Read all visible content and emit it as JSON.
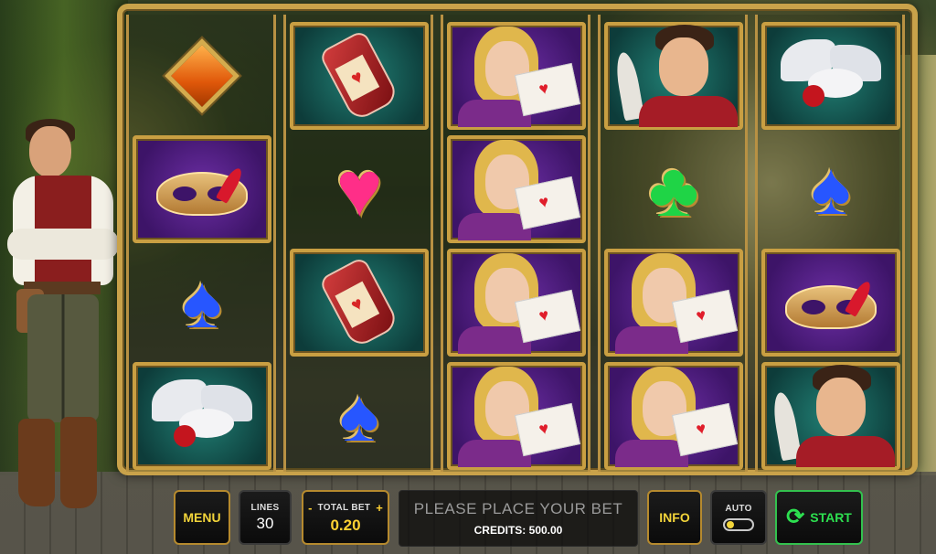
{
  "game": {
    "message": "PLEASE PLACE YOUR BET",
    "credits_label": "CREDITS: 500.00"
  },
  "controls": {
    "menu_label": "MENU",
    "lines_label": "LINES",
    "lines_value": "30",
    "bet_minus": "-",
    "bet_label": "TOTAL BET",
    "bet_plus": "+",
    "bet_value": "0.20",
    "info_label": "INFO",
    "auto_label": "AUTO",
    "start_label": "START"
  },
  "reels": [
    [
      "orange-diamond",
      "purple-mask",
      "blue-spade",
      "dove"
    ],
    [
      "potion",
      "pink-heart",
      "potion",
      "blue-spade"
    ],
    [
      "girl-letter",
      "girl-letter",
      "girl-letter",
      "girl-letter"
    ],
    [
      "prince",
      "green-club",
      "girl-letter",
      "girl-letter"
    ],
    [
      "dove",
      "blue-spade",
      "purple-mask",
      "prince"
    ]
  ],
  "colors": {
    "gold_frame": "#c9a24a",
    "button_text": "#f2d43a",
    "start_green": "#2de050"
  }
}
